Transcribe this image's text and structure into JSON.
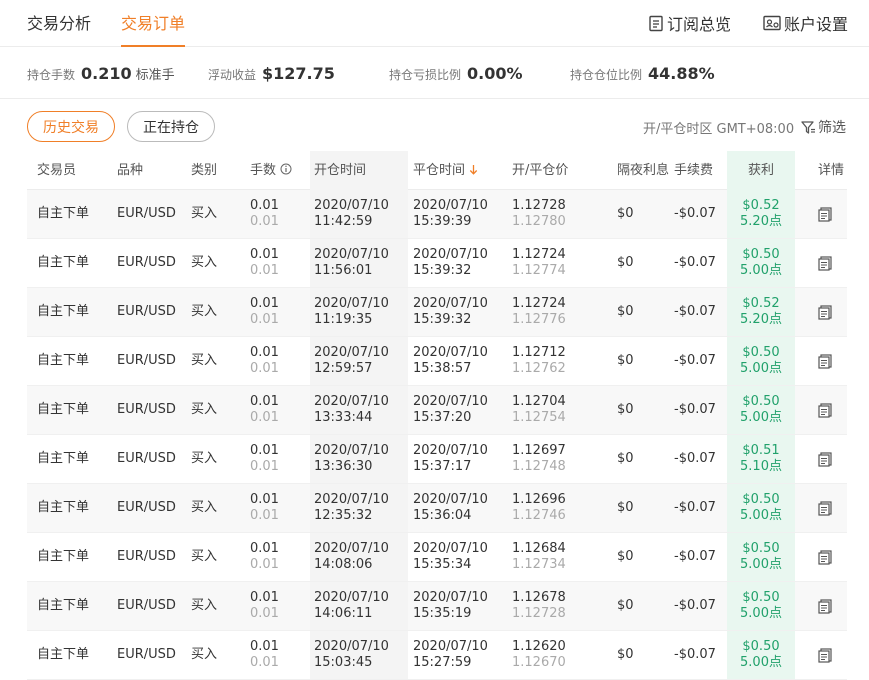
{
  "nav": {
    "tabs": [
      "交易分析",
      "交易订单"
    ],
    "subscription_label": "订阅总览",
    "account_label": "账户设置"
  },
  "stats": [
    {
      "label": "持仓手数",
      "value": "0.210",
      "unit": "标准手"
    },
    {
      "label": "浮动收益",
      "value": "$127.75",
      "unit": ""
    },
    {
      "label": "持仓亏损比例",
      "value": "0.00%",
      "unit": ""
    },
    {
      "label": "持仓仓位比例",
      "value": "44.88%",
      "unit": ""
    }
  ],
  "filters": {
    "history_label": "历史交易",
    "open_label": "正在持仓",
    "timezone": "开/平仓时区 GMT+08:00",
    "filter_label": "筛选"
  },
  "table": {
    "headers": {
      "trader": "交易员",
      "symbol": "品种",
      "type": "类别",
      "lots": "手数",
      "open_time": "开仓时间",
      "close_time": "平仓时间",
      "price": "开/平仓价",
      "swap": "隔夜利息",
      "fee": "手续费",
      "profit": "获利",
      "detail": "详情"
    },
    "rows": [
      {
        "trader": "自主下单",
        "symbol": "EUR/USD",
        "type": "买入",
        "lots": "0.01",
        "lots2": "0.01",
        "open_date": "2020/07/10",
        "open_time": "11:42:59",
        "close_date": "2020/07/10",
        "close_time": "15:39:39",
        "open_price": "1.12728",
        "close_price": "1.12780",
        "swap": "$0",
        "fee": "-$0.07",
        "profit": "$0.52",
        "points": "5.20点"
      },
      {
        "trader": "自主下单",
        "symbol": "EUR/USD",
        "type": "买入",
        "lots": "0.01",
        "lots2": "0.01",
        "open_date": "2020/07/10",
        "open_time": "11:56:01",
        "close_date": "2020/07/10",
        "close_time": "15:39:32",
        "open_price": "1.12724",
        "close_price": "1.12774",
        "swap": "$0",
        "fee": "-$0.07",
        "profit": "$0.50",
        "points": "5.00点"
      },
      {
        "trader": "自主下单",
        "symbol": "EUR/USD",
        "type": "买入",
        "lots": "0.01",
        "lots2": "0.01",
        "open_date": "2020/07/10",
        "open_time": "11:19:35",
        "close_date": "2020/07/10",
        "close_time": "15:39:32",
        "open_price": "1.12724",
        "close_price": "1.12776",
        "swap": "$0",
        "fee": "-$0.07",
        "profit": "$0.52",
        "points": "5.20点"
      },
      {
        "trader": "自主下单",
        "symbol": "EUR/USD",
        "type": "买入",
        "lots": "0.01",
        "lots2": "0.01",
        "open_date": "2020/07/10",
        "open_time": "12:59:57",
        "close_date": "2020/07/10",
        "close_time": "15:38:57",
        "open_price": "1.12712",
        "close_price": "1.12762",
        "swap": "$0",
        "fee": "-$0.07",
        "profit": "$0.50",
        "points": "5.00点"
      },
      {
        "trader": "自主下单",
        "symbol": "EUR/USD",
        "type": "买入",
        "lots": "0.01",
        "lots2": "0.01",
        "open_date": "2020/07/10",
        "open_time": "13:33:44",
        "close_date": "2020/07/10",
        "close_time": "15:37:20",
        "open_price": "1.12704",
        "close_price": "1.12754",
        "swap": "$0",
        "fee": "-$0.07",
        "profit": "$0.50",
        "points": "5.00点"
      },
      {
        "trader": "自主下单",
        "symbol": "EUR/USD",
        "type": "买入",
        "lots": "0.01",
        "lots2": "0.01",
        "open_date": "2020/07/10",
        "open_time": "13:36:30",
        "close_date": "2020/07/10",
        "close_time": "15:37:17",
        "open_price": "1.12697",
        "close_price": "1.12748",
        "swap": "$0",
        "fee": "-$0.07",
        "profit": "$0.51",
        "points": "5.10点"
      },
      {
        "trader": "自主下单",
        "symbol": "EUR/USD",
        "type": "买入",
        "lots": "0.01",
        "lots2": "0.01",
        "open_date": "2020/07/10",
        "open_time": "12:35:32",
        "close_date": "2020/07/10",
        "close_time": "15:36:04",
        "open_price": "1.12696",
        "close_price": "1.12746",
        "swap": "$0",
        "fee": "-$0.07",
        "profit": "$0.50",
        "points": "5.00点"
      },
      {
        "trader": "自主下单",
        "symbol": "EUR/USD",
        "type": "买入",
        "lots": "0.01",
        "lots2": "0.01",
        "open_date": "2020/07/10",
        "open_time": "14:08:06",
        "close_date": "2020/07/10",
        "close_time": "15:35:34",
        "open_price": "1.12684",
        "close_price": "1.12734",
        "swap": "$0",
        "fee": "-$0.07",
        "profit": "$0.50",
        "points": "5.00点"
      },
      {
        "trader": "自主下单",
        "symbol": "EUR/USD",
        "type": "买入",
        "lots": "0.01",
        "lots2": "0.01",
        "open_date": "2020/07/10",
        "open_time": "14:06:11",
        "close_date": "2020/07/10",
        "close_time": "15:35:19",
        "open_price": "1.12678",
        "close_price": "1.12728",
        "swap": "$0",
        "fee": "-$0.07",
        "profit": "$0.50",
        "points": "5.00点"
      },
      {
        "trader": "自主下单",
        "symbol": "EUR/USD",
        "type": "买入",
        "lots": "0.01",
        "lots2": "0.01",
        "open_date": "2020/07/10",
        "open_time": "15:03:45",
        "close_date": "2020/07/10",
        "close_time": "15:27:59",
        "open_price": "1.12620",
        "close_price": "1.12670",
        "swap": "$0",
        "fee": "-$0.07",
        "profit": "$0.50",
        "points": "5.00点"
      }
    ]
  },
  "colors": {
    "accent": "#f07f28",
    "profit": "#21a16b",
    "profit_bg": "#e9f7f0"
  },
  "icons": [
    "subscription-icon",
    "account-settings-icon",
    "filter-icon",
    "info-icon",
    "sort-down-icon",
    "detail-icon"
  ]
}
